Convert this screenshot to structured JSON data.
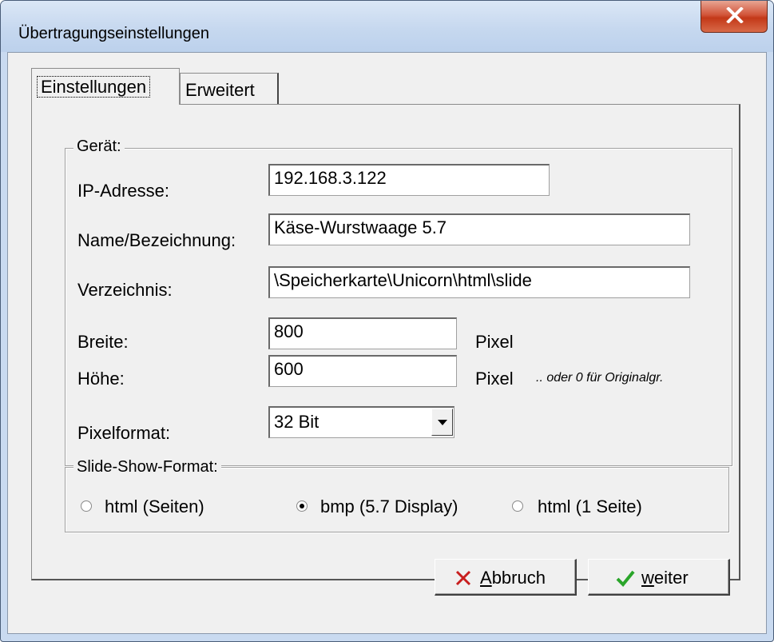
{
  "window": {
    "title": "Übertragungseinstellungen",
    "close_glyph": "X"
  },
  "tabs": [
    {
      "label": "Einstellungen",
      "active": true
    },
    {
      "label": "Erweitert",
      "active": false
    }
  ],
  "device_group": {
    "title": "Gerät:",
    "ip_label": "IP-Adresse:",
    "ip_value": "192.168.3.122",
    "name_label": "Name/Bezeichnung:",
    "name_value": "Käse-Wurstwaage 5.7",
    "dir_label": "Verzeichnis:",
    "dir_value": "\\Speicherkarte\\Unicorn\\html\\slide",
    "width_label": "Breite:",
    "width_value": "800",
    "width_unit": "Pixel",
    "height_label": "Höhe:",
    "height_value": "600",
    "height_unit": "Pixel",
    "height_note": ".. oder 0 für Originalgr.",
    "pixelformat_label": "Pixelformat:",
    "pixelformat_value": "32 Bit"
  },
  "slideshow_group": {
    "title": "Slide-Show-Format:",
    "options": [
      {
        "label": "html (Seiten)",
        "selected": false
      },
      {
        "label": "bmp (5.7 Display)",
        "selected": true
      },
      {
        "label": "html (1 Seite)",
        "selected": false
      }
    ]
  },
  "buttons": {
    "cancel": {
      "mnemonic": "A",
      "rest": "bbruch",
      "icon": "x-icon",
      "icon_color": "#c81e1e"
    },
    "next": {
      "mnemonic": "w",
      "rest": "eiter",
      "icon": "checkmark-icon",
      "icon_color": "#2aa52a"
    }
  }
}
